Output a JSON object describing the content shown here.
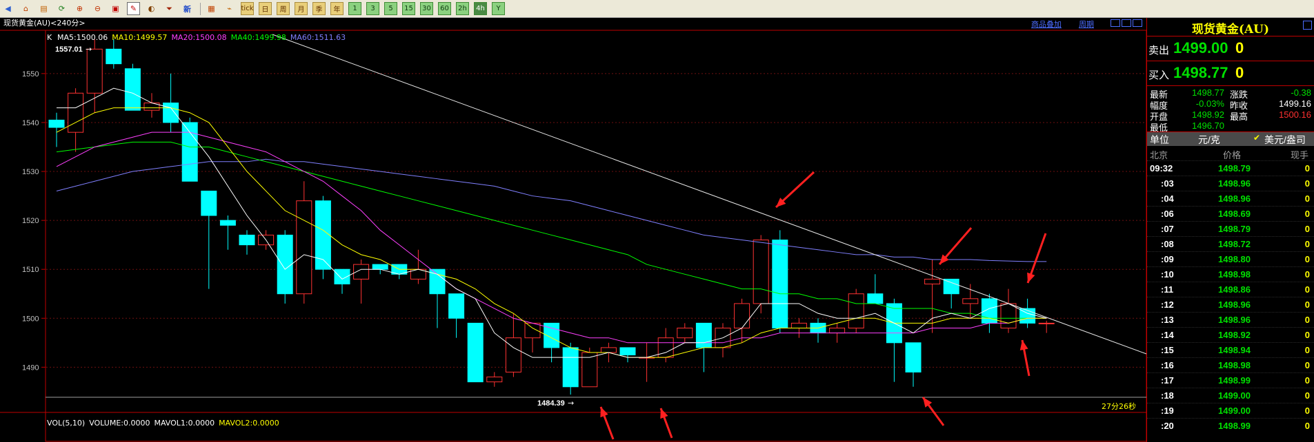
{
  "toolbar": {
    "icons": [
      "back-icon",
      "home-icon",
      "order-icon",
      "refresh-icon",
      "zoom-in-icon",
      "zoom-out-icon",
      "window-icon",
      "draw-icon",
      "theme-icon",
      "filter-icon",
      "new-icon",
      "table-icon",
      "chart-icon"
    ],
    "new_label": "新",
    "period_buttons": [
      "tick",
      "日",
      "周",
      "月",
      "季",
      "年",
      "1",
      "3",
      "5",
      "15",
      "30",
      "60",
      "2h",
      "4h",
      "Y"
    ]
  },
  "chart": {
    "title": "现货黄金(AU)<240分>",
    "k_label": "K",
    "ma_labels": [
      {
        "text": "MA5:1500.06",
        "color": "#ffffff"
      },
      {
        "text": "MA10:1499.57",
        "color": "#ffff00"
      },
      {
        "text": "MA20:1500.08",
        "color": "#ff40ff"
      },
      {
        "text": "MA40:1499.98",
        "color": "#00ff00"
      },
      {
        "text": "MA60:1511.63",
        "color": "#8080ff"
      }
    ],
    "links": [
      "商品叠加",
      "周期"
    ],
    "y_ticks": [
      "1550",
      "1540",
      "1530",
      "1520",
      "1510",
      "1500",
      "1490"
    ],
    "high_label": "1557.01",
    "low_label": "1484.39",
    "countdown": "27分26秒",
    "volume_label": "VOL(5,10)",
    "volume_items": [
      {
        "text": "VOLUME:0.0000",
        "color": "#ffffff"
      },
      {
        "text": "MAVOL1:0.0000",
        "color": "#ffffff"
      },
      {
        "text": "MAVOL2:0.0000",
        "color": "#ffff00"
      }
    ]
  },
  "chart_data": {
    "type": "candlestick",
    "ylim": [
      1484,
      1558
    ],
    "candles": [
      [
        1540.5,
        1542,
        1535,
        1539
      ],
      [
        1538,
        1547,
        1534,
        1546
      ],
      [
        1546,
        1557,
        1542,
        1555
      ],
      [
        1555,
        1557,
        1551,
        1552
      ],
      [
        1551,
        1552,
        1542.5,
        1542.5
      ],
      [
        1542.5,
        1546,
        1541,
        1544
      ],
      [
        1544,
        1550,
        1538,
        1540
      ],
      [
        1540,
        1541,
        1528,
        1528
      ],
      [
        1526,
        1526,
        1506,
        1521
      ],
      [
        1520,
        1521,
        1514,
        1519
      ],
      [
        1517,
        1518,
        1513,
        1515
      ],
      [
        1515,
        1518,
        1514,
        1517
      ],
      [
        1517,
        1518,
        1503,
        1505
      ],
      [
        1505,
        1528,
        1503,
        1524
      ],
      [
        1524,
        1525,
        1508,
        1510
      ],
      [
        1510,
        1510,
        1505,
        1507
      ],
      [
        1508,
        1512,
        1503,
        1511
      ],
      [
        1511,
        1511,
        1509,
        1510
      ],
      [
        1511,
        1511,
        1508,
        1509
      ],
      [
        1508,
        1514,
        1507,
        1510
      ],
      [
        1510,
        1510,
        1498,
        1505
      ],
      [
        1505,
        1505,
        1496,
        1500
      ],
      [
        1499,
        1499,
        1487,
        1487
      ],
      [
        1487,
        1489,
        1486,
        1488
      ],
      [
        1489,
        1501,
        1488,
        1496
      ],
      [
        1496,
        1498,
        1493,
        1499
      ],
      [
        1499,
        1499,
        1491,
        1494
      ],
      [
        1494,
        1495,
        1484.4,
        1486
      ],
      [
        1486,
        1494,
        1486,
        1493
      ],
      [
        1493,
        1495,
        1491,
        1494
      ],
      [
        1494,
        1494,
        1491,
        1492.5
      ],
      [
        1492,
        1495,
        1487,
        1492
      ],
      [
        1492,
        1498,
        1491,
        1496
      ],
      [
        1496,
        1499,
        1495,
        1498
      ],
      [
        1499,
        1499,
        1489,
        1494
      ],
      [
        1494,
        1499,
        1492,
        1498
      ],
      [
        1498,
        1504,
        1495,
        1503
      ],
      [
        1503,
        1517,
        1501,
        1516
      ],
      [
        1516,
        1518,
        1497,
        1498
      ],
      [
        1498,
        1500,
        1496,
        1499
      ],
      [
        1499,
        1500,
        1495,
        1497
      ],
      [
        1497,
        1499,
        1495,
        1498
      ],
      [
        1498,
        1506,
        1497,
        1505
      ],
      [
        1505,
        1509,
        1503,
        1503
      ],
      [
        1503,
        1504,
        1487,
        1495
      ],
      [
        1495,
        1495,
        1486,
        1489
      ],
      [
        1507,
        1512,
        1497,
        1508
      ],
      [
        1508,
        1508,
        1502,
        1505
      ],
      [
        1503,
        1507,
        1500,
        1504
      ],
      [
        1504,
        1505,
        1497,
        1499
      ],
      [
        1498,
        1506,
        1497,
        1503
      ],
      [
        1502,
        1504,
        1498,
        1499
      ],
      [
        1499,
        1499.5,
        1497,
        1499
      ]
    ],
    "ma5": [
      1543,
      1543,
      1545,
      1547,
      1546,
      1544,
      1543,
      1538,
      1533,
      1527,
      1521,
      1516,
      1510,
      1513,
      1512,
      1508,
      1510,
      1510,
      1509,
      1510,
      1509,
      1506,
      1504,
      1497,
      1494,
      1492,
      1492,
      1492,
      1492,
      1493,
      1492,
      1492,
      1493,
      1495,
      1495,
      1496,
      1498,
      1503,
      1503,
      1503,
      1501,
      1500,
      1500,
      1501,
      1499,
      1497,
      1500,
      1501,
      1500,
      1502,
      1503,
      1501,
      1500
    ],
    "ma10": [
      1538,
      1540,
      1542,
      1543,
      1543,
      1543,
      1543,
      1542,
      1540,
      1535,
      1530,
      1526,
      1522,
      1520,
      1518,
      1515,
      1513,
      1512,
      1510,
      1510,
      1509,
      1508,
      1506,
      1503,
      1501,
      1498,
      1496,
      1494,
      1493,
      1493,
      1492,
      1492,
      1492,
      1493,
      1494,
      1494,
      1495,
      1497,
      1498,
      1498,
      1498,
      1499,
      1500,
      1500,
      1499,
      1499,
      1499,
      1500,
      1500,
      1500,
      1499,
      1500,
      1500
    ],
    "ma20": [
      1531,
      1533,
      1535,
      1536,
      1537,
      1538,
      1538,
      1538,
      1537,
      1536,
      1535,
      1534,
      1532,
      1530,
      1528,
      1525,
      1522,
      1518,
      1515,
      1512,
      1509,
      1506,
      1504,
      1502,
      1500,
      1499,
      1498,
      1497,
      1496,
      1496,
      1495,
      1495,
      1495,
      1495,
      1495,
      1495,
      1496,
      1496,
      1497,
      1497,
      1497,
      1497,
      1497,
      1497,
      1497,
      1497,
      1498,
      1498,
      1498,
      1499,
      1499,
      1500,
      1500
    ],
    "ma40": [
      1534,
      1534.5,
      1535,
      1535.5,
      1536,
      1536,
      1536,
      1535,
      1535,
      1534,
      1533,
      1532,
      1531,
      1530,
      1529,
      1528,
      1527,
      1526,
      1525,
      1524,
      1523,
      1522,
      1521,
      1520,
      1519,
      1518,
      1517,
      1516,
      1515,
      1514,
      1513,
      1511,
      1510,
      1509,
      1508,
      1507,
      1506,
      1506,
      1505,
      1505,
      1504,
      1504,
      1503,
      1503,
      1502,
      1502,
      1502,
      1501,
      1501,
      1500,
      1500,
      1500,
      1500
    ],
    "ma60": [
      1526,
      1527,
      1528,
      1529,
      1530,
      1530.5,
      1531,
      1531.5,
      1532,
      1532,
      1532,
      1532.5,
      1532,
      1532,
      1531.5,
      1531,
      1530.5,
      1530,
      1529.5,
      1529,
      1528.5,
      1528,
      1527.5,
      1527,
      1526,
      1525,
      1524.5,
      1524,
      1523,
      1522,
      1521,
      1520,
      1519,
      1518,
      1517,
      1516.5,
      1516,
      1515.5,
      1515,
      1514.5,
      1514,
      1513.5,
      1513,
      1513,
      1512.5,
      1512.5,
      1512,
      1512,
      1512,
      1511.8,
      1511.7,
      1511.6,
      1511.6
    ]
  },
  "panel": {
    "title": "现货黄金(AU)",
    "sell_label": "卖出",
    "sell_price": "1499.00",
    "sell_vol": "0",
    "buy_label": "买入",
    "buy_price": "1498.77",
    "buy_vol": "0",
    "stats": [
      {
        "label": "最新",
        "value": "1498.77",
        "color": "#00e000",
        "label2": "涨跌",
        "value2": "-0.38",
        "color2": "#00e000"
      },
      {
        "label": "幅度",
        "value": "-0.03%",
        "color": "#00e000",
        "label2": "昨收",
        "value2": "1499.16",
        "color2": "#ffffff"
      },
      {
        "label": "开盘",
        "value": "1498.92",
        "color": "#00e000",
        "label2": "最高",
        "value2": "1500.16",
        "color2": "#ff3030"
      },
      {
        "label": "最低",
        "value": "1496.70",
        "color": "#00e000",
        "label2": "",
        "value2": "",
        "color2": "#ffffff"
      }
    ],
    "unit_label": "单位",
    "unit_value": "元/克",
    "unit_alt": "美元/盎司",
    "tick_header": {
      "time": "北京",
      "price": "价格",
      "vol": "现手"
    },
    "ticks": [
      {
        "time": "09:32",
        "price": "1498.79",
        "vol": "0"
      },
      {
        "time": ":03",
        "price": "1498.96",
        "vol": "0"
      },
      {
        "time": ":04",
        "price": "1498.96",
        "vol": "0"
      },
      {
        "time": ":06",
        "price": "1498.69",
        "vol": "0"
      },
      {
        "time": ":07",
        "price": "1498.79",
        "vol": "0"
      },
      {
        "time": ":08",
        "price": "1498.72",
        "vol": "0"
      },
      {
        "time": ":09",
        "price": "1498.80",
        "vol": "0"
      },
      {
        "time": ":10",
        "price": "1498.98",
        "vol": "0"
      },
      {
        "time": ":11",
        "price": "1498.86",
        "vol": "0"
      },
      {
        "time": ":12",
        "price": "1498.96",
        "vol": "0"
      },
      {
        "time": ":13",
        "price": "1498.96",
        "vol": "0"
      },
      {
        "time": ":14",
        "price": "1498.92",
        "vol": "0"
      },
      {
        "time": ":15",
        "price": "1498.94",
        "vol": "0"
      },
      {
        "time": ":16",
        "price": "1498.98",
        "vol": "0"
      },
      {
        "time": ":17",
        "price": "1498.99",
        "vol": "0"
      },
      {
        "time": ":18",
        "price": "1499.00",
        "vol": "0"
      },
      {
        "time": ":19",
        "price": "1499.00",
        "vol": "0"
      },
      {
        "time": ":20",
        "price": "1498.99",
        "vol": "0"
      }
    ]
  }
}
